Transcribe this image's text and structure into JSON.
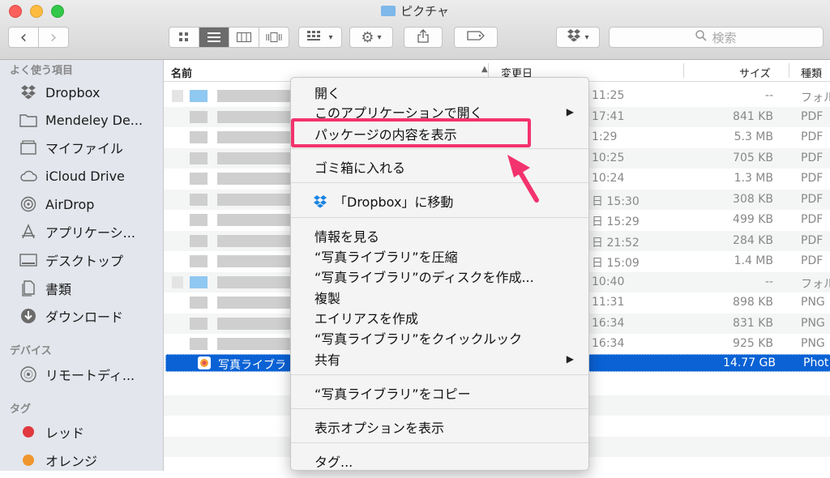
{
  "window": {
    "title": "ピクチャ"
  },
  "toolbar": {
    "back": "‹",
    "forward": "›",
    "search_placeholder": "検索"
  },
  "sidebar": {
    "favorites_head": "よく使う項目",
    "favorites": [
      {
        "label": "Dropbox",
        "icon": "dropbox-icon"
      },
      {
        "label": "Mendeley De...",
        "icon": "folder-icon"
      },
      {
        "label": "マイファイル",
        "icon": "all-my-files-icon"
      },
      {
        "label": "iCloud Drive",
        "icon": "cloud-icon"
      },
      {
        "label": "AirDrop",
        "icon": "airdrop-icon"
      },
      {
        "label": "アプリケーシ...",
        "icon": "applications-icon"
      },
      {
        "label": "デスクトップ",
        "icon": "desktop-icon"
      },
      {
        "label": "書類",
        "icon": "documents-icon"
      },
      {
        "label": "ダウンロード",
        "icon": "downloads-icon"
      }
    ],
    "devices_head": "デバイス",
    "devices": [
      {
        "label": "リモートディ...",
        "icon": "disc-icon"
      }
    ],
    "tags_head": "タグ",
    "tags": [
      {
        "label": "レッド",
        "color": "#e0383e"
      },
      {
        "label": "オレンジ",
        "color": "#f0962e"
      }
    ]
  },
  "columns": {
    "name": "名前",
    "date": "変更日",
    "size": "サイズ",
    "kind": "種類"
  },
  "rows": [
    {
      "date": "11:25",
      "size": "--",
      "kind": "フォル"
    },
    {
      "date": "17:41",
      "size": "841 KB",
      "kind": "PDF"
    },
    {
      "date": "1:29",
      "size": "5.3 MB",
      "kind": "PDF"
    },
    {
      "date": "10:25",
      "size": "705 KB",
      "kind": "PDF"
    },
    {
      "date": "10:24",
      "size": "1.3 MB",
      "kind": "PDF"
    },
    {
      "date": "日 15:30",
      "size": "308 KB",
      "kind": "PDF"
    },
    {
      "date": "日 15:29",
      "size": "499 KB",
      "kind": "PDF"
    },
    {
      "date": "日 21:52",
      "size": "284 KB",
      "kind": "PDF"
    },
    {
      "date": "日 15:09",
      "size": "1.4 MB",
      "kind": "PDF"
    },
    {
      "date": "10:40",
      "size": "--",
      "kind": "フォル"
    },
    {
      "date": "11:31",
      "size": "898 KB",
      "kind": "PNG"
    },
    {
      "date": "16:34",
      "size": "831 KB",
      "kind": "PNG"
    },
    {
      "date": "16:34",
      "size": "925 KB",
      "kind": "PNG"
    }
  ],
  "selected_row": {
    "name": "写真ライブラ",
    "size": "14.77 GB",
    "kind": "Phot"
  },
  "context_menu": {
    "open": "開く",
    "open_with": "このアプリケーションで開く",
    "show_package": "パッケージの内容を表示",
    "trash": "ゴミ箱に入れる",
    "move_dropbox": "「Dropbox」に移動",
    "get_info": "情報を見る",
    "compress": "“写真ライブラリ”を圧縮",
    "burn": "“写真ライブラリ”のディスクを作成...",
    "duplicate": "複製",
    "alias": "エイリアスを作成",
    "quicklook": "“写真ライブラリ”をクイックルック",
    "share": "共有",
    "copy": "“写真ライブラリ”をコピー",
    "view_options": "表示オプションを表示",
    "tags": "タグ..."
  },
  "colors": {
    "selection": "#0a62d5",
    "highlight": "#f3336d"
  }
}
